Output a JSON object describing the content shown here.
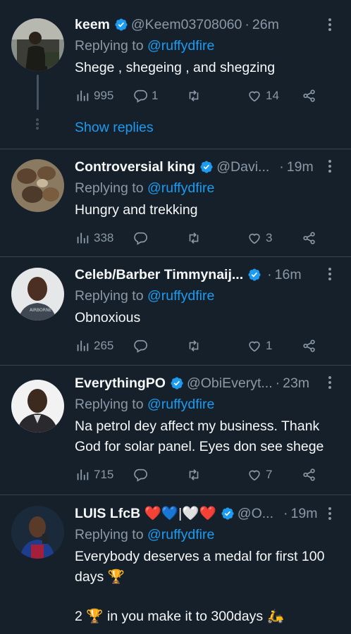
{
  "colors": {
    "background": "#15202b",
    "text": "#f7f9f9",
    "muted": "#8b98a5",
    "accent": "#1d9bf0",
    "divider": "#38444d"
  },
  "icons": {
    "verified": "verified-badge-icon",
    "more": "more-dots-icon",
    "views": "bar-chart-icon",
    "reply": "speech-bubble-icon",
    "retweet": "retweet-arrows-icon",
    "like": "heart-icon",
    "share": "share-icon"
  },
  "tweets": [
    {
      "name": "keem",
      "handle": "@Keem03708060",
      "sep": "·",
      "time": "26m",
      "replying_prefix": "Replying to",
      "mention": "@ruffydfire",
      "text": "Shege , shegeing , and shegzing",
      "views": "995",
      "replies": "1",
      "retweets": "",
      "likes": "14",
      "show_replies": "Show replies"
    },
    {
      "name": "Controversial king",
      "handle": "@Davi...",
      "sep": "·",
      "time": "19m",
      "replying_prefix": "Replying to",
      "mention": "@ruffydfire",
      "text": "Hungry and trekking",
      "views": "338",
      "replies": "",
      "retweets": "",
      "likes": "3"
    },
    {
      "name": "Celeb/Barber Timmynaij...",
      "handle": "",
      "sep": "·",
      "time": "16m",
      "replying_prefix": "Replying to",
      "mention": "@ruffydfire",
      "text": "Obnoxious",
      "views": "265",
      "replies": "",
      "retweets": "",
      "likes": "1"
    },
    {
      "name": "EverythingPO",
      "handle": "@ObiEveryt...",
      "sep": "·",
      "time": "23m",
      "replying_prefix": "Replying to",
      "mention": "@ruffydfire",
      "text": "Na petrol dey affect my business. Thank God for solar panel. Eyes don see shege",
      "views": "715",
      "replies": "",
      "retweets": "",
      "likes": "7"
    },
    {
      "name_plain": "LUIS LfcB",
      "name_hearts": "❤️💙|🤍❤️",
      "handle": "@O...",
      "sep": "·",
      "time": "19m",
      "replying_prefix": "Replying to",
      "mention": "@ruffydfire",
      "text_line1": "Everybody deserves a medal for first 100 days 🏆",
      "text_line2": "2 🏆 in you make it to 300days 🛵"
    }
  ]
}
